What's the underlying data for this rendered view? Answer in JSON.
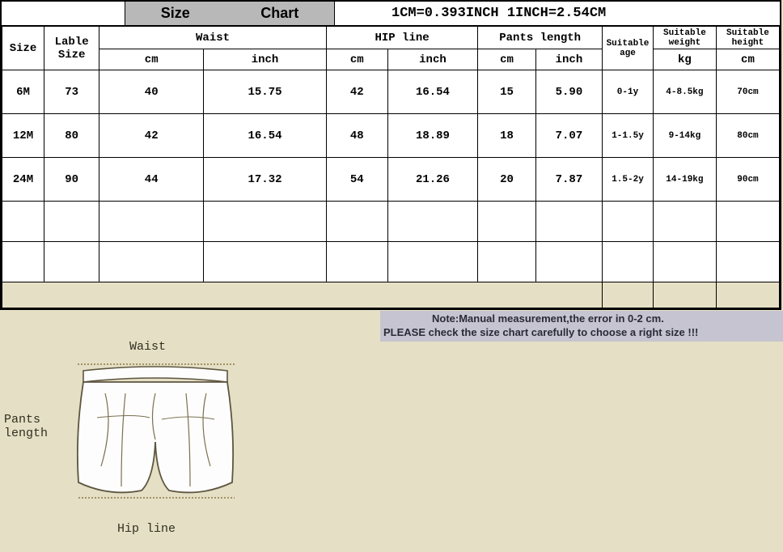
{
  "header": {
    "title_a": "Size",
    "title_b": "Chart",
    "conversion": "1CM=0.393INCH 1INCH=2.54CM"
  },
  "columns": {
    "size": "Size",
    "label_size": "Lable Size",
    "waist": "Waist",
    "waist_cm": "cm",
    "waist_in": "inch",
    "hip": "HIP line",
    "hip_cm": "cm",
    "hip_in": "inch",
    "pants": "Pants length",
    "pants_cm": "cm",
    "pants_in": "inch",
    "age": "Suitable age",
    "weight": "Suitable weight",
    "weight_unit": "kg",
    "height": "Suitable height",
    "height_unit": "cm"
  },
  "rows": [
    {
      "size": "6M",
      "label": "73",
      "waist_cm": "40",
      "waist_in": "15.75",
      "hip_cm": "42",
      "hip_in": "16.54",
      "pants_cm": "15",
      "pants_in": "5.90",
      "age": "0-1y",
      "weight": "4-8.5kg",
      "height": "70cm"
    },
    {
      "size": "12M",
      "label": "80",
      "waist_cm": "42",
      "waist_in": "16.54",
      "hip_cm": "48",
      "hip_in": "18.89",
      "pants_cm": "18",
      "pants_in": "7.07",
      "age": "1-1.5y",
      "weight": "9-14kg",
      "height": "80cm"
    },
    {
      "size": "24M",
      "label": "90",
      "waist_cm": "44",
      "waist_in": "17.32",
      "hip_cm": "54",
      "hip_in": "21.26",
      "pants_cm": "20",
      "pants_in": "7.87",
      "age": "1.5-2y",
      "weight": "14-19kg",
      "height": "90cm"
    }
  ],
  "note": {
    "line1": "Note:Manual measurement,the error in 0-2 cm.",
    "line2": "PLEASE check the size chart carefully to choose a right size !!!"
  },
  "diagram": {
    "waist": "Waist",
    "pants_length": "Pants\nlength",
    "hip_line": "Hip line"
  }
}
